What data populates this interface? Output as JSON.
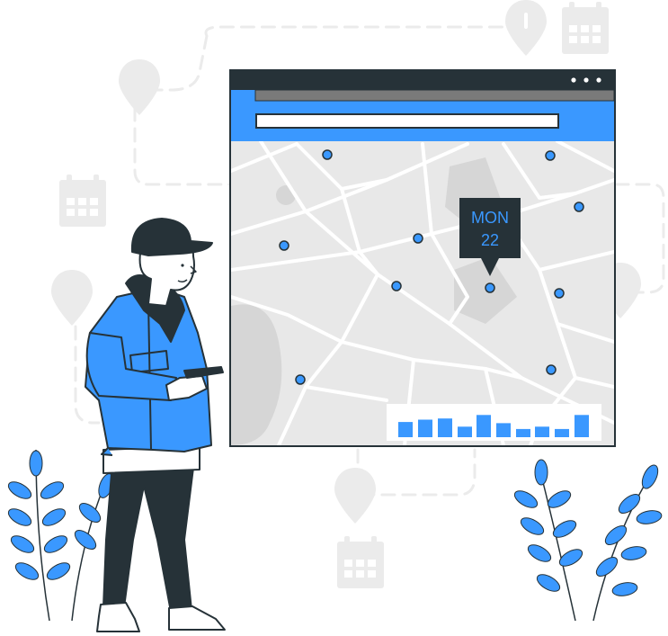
{
  "colors": {
    "accent": "#3a98ff",
    "dark": "#263238",
    "map_bg": "#e8e8e8",
    "map_roads": "#ffffff",
    "map_park": "#d6d6d6",
    "ghost": "#ebebeb",
    "skin": "#ffffff"
  },
  "browser": {
    "window_controls": [
      "dot",
      "dot",
      "dot"
    ],
    "address_bar_value": "",
    "header_color": "#3a98ff"
  },
  "map": {
    "marker_icon": "location-dot-icon",
    "event_tooltip": {
      "day": "MON",
      "date": "22"
    },
    "activity_chart": {
      "type": "bar",
      "values": [
        0.65,
        0.75,
        0.8,
        0.45,
        0.95,
        0.6,
        0.35,
        0.45,
        0.35,
        0.95
      ]
    }
  },
  "background_icons": [
    "calendar-icon",
    "map-pin-icon"
  ],
  "person": {
    "device": "smartphone-icon"
  }
}
